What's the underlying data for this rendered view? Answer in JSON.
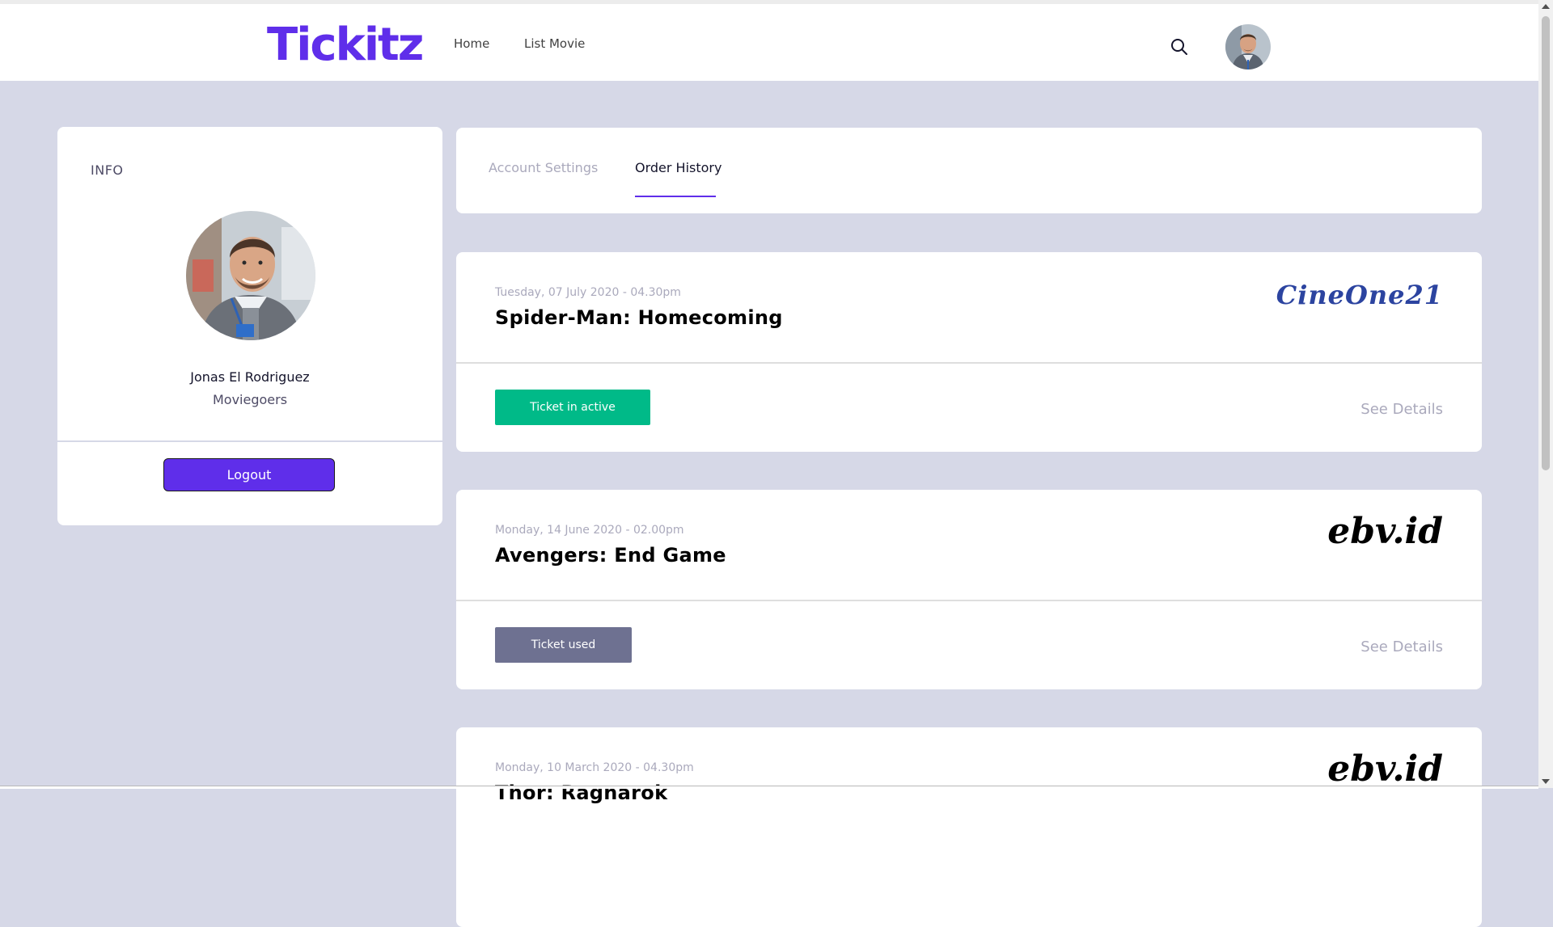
{
  "header": {
    "logo": "Tickitz",
    "nav": [
      {
        "label": "Home"
      },
      {
        "label": "List Movie"
      }
    ],
    "search_icon": "search-icon",
    "avatar_icon": "user-avatar"
  },
  "profile": {
    "section_title": "INFO",
    "name": "Jonas El Rodriguez",
    "role": "Moviegoers",
    "logout_label": "Logout"
  },
  "tabs": [
    {
      "label": "Account Settings",
      "active": false
    },
    {
      "label": "Order History",
      "active": true
    }
  ],
  "orders": [
    {
      "date": "Tuesday, 07 July 2020 - 04.30pm",
      "title": "Spider-Man: Homecoming",
      "cinema": "CineOne21",
      "status": "Ticket in active",
      "status_color": "#00BA88",
      "details_label": "See Details"
    },
    {
      "date": "Monday, 14 June 2020 - 02.00pm",
      "title": "Avengers: End Game",
      "cinema": "ebv.id",
      "status": "Ticket used",
      "status_color": "#6E7191",
      "details_label": "See Details"
    },
    {
      "date": "Monday, 10 March 2020 - 04.30pm",
      "title": "Thor: Ragnarok",
      "cinema": "ebv.id"
    }
  ],
  "colors": {
    "accent": "#5F2EEA",
    "background": "#D6D8E7",
    "active": "#00BA88",
    "used": "#6E7191"
  }
}
